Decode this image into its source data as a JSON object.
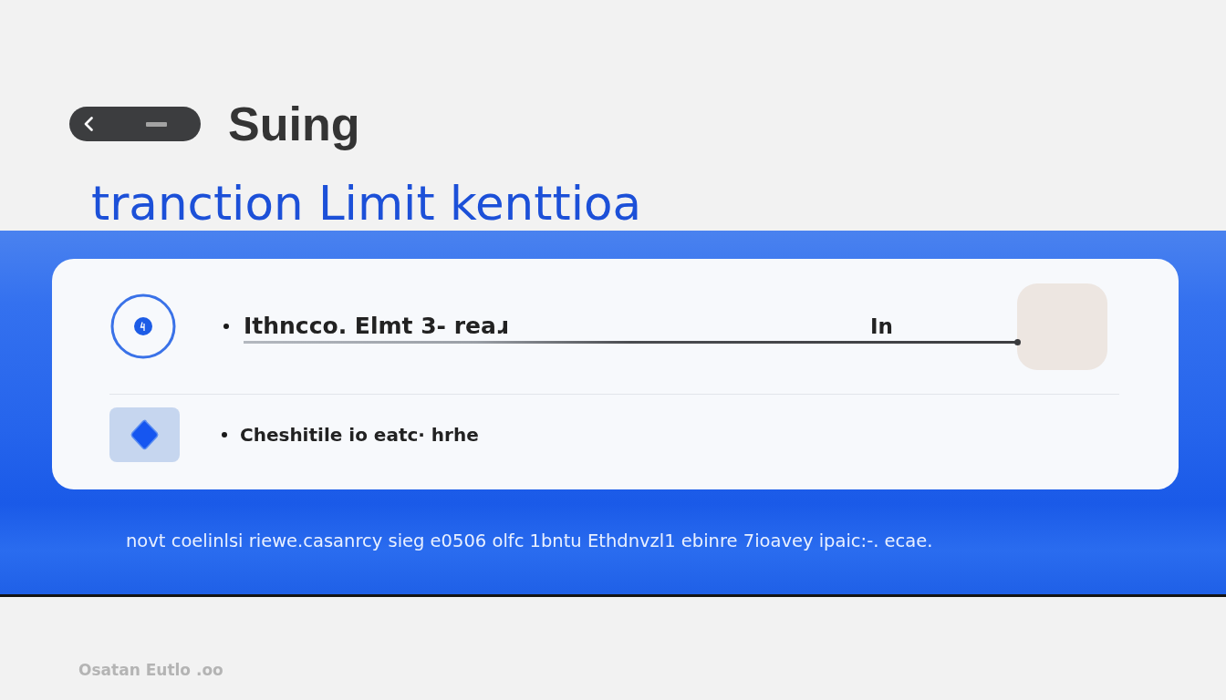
{
  "title": "Suing",
  "subtitle": "tranction Limit kenttioa",
  "card": {
    "rows": [
      {
        "kind": "field",
        "value": "Ithncco. Elmt 3- reaɹ",
        "suffix": "In"
      },
      {
        "kind": "plain",
        "label": "Cheshitile io eatc· hrhe"
      }
    ]
  },
  "footer_text": "novt coelinlsi riewe.casanrcy  sieg e0506 olfc 1bntu Ethdnvzl1 ebinre 7ioavey ipaic:-. ecae.",
  "footnote": "Osatan Eutlo .oo"
}
